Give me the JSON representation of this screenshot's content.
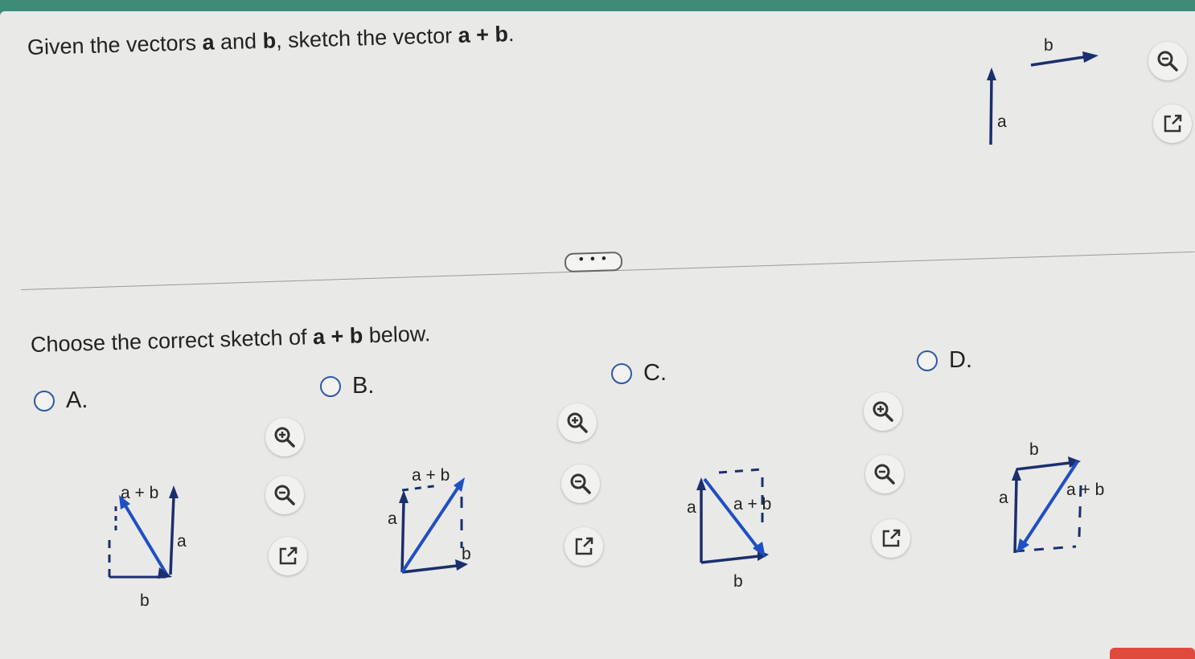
{
  "question": {
    "prefix": "Given the vectors ",
    "vec_a": "a",
    "mid": " and ",
    "vec_b": "b",
    "suffix": ", sketch the vector ",
    "sum": "a + b",
    "end": "."
  },
  "given_figure": {
    "label_a": "a",
    "label_b": "b"
  },
  "more_button": "• • •",
  "prompt": {
    "prefix": "Choose the correct sketch of ",
    "sum": "a + b",
    "suffix": " below."
  },
  "options": [
    {
      "label": "A.",
      "sum_label": "a + b",
      "label_a": "a",
      "label_b": "b"
    },
    {
      "label": "B.",
      "sum_label": "a + b",
      "label_a": "a",
      "label_b": "b"
    },
    {
      "label": "C.",
      "sum_label": "a + b",
      "label_a": "a",
      "label_b": "b"
    },
    {
      "label": "D.",
      "sum_label": "a + b",
      "label_a": "a",
      "label_b": "b"
    }
  ],
  "icons": [
    "zoom-in-icon",
    "zoom-out-icon",
    "external-link-icon"
  ],
  "colors": {
    "header": "#3d8c78",
    "vector_blue": "#1f4fc4",
    "vector_dark": "#1a2f6e",
    "radio": "#2f5aa8",
    "button_red": "#e04a3c"
  }
}
